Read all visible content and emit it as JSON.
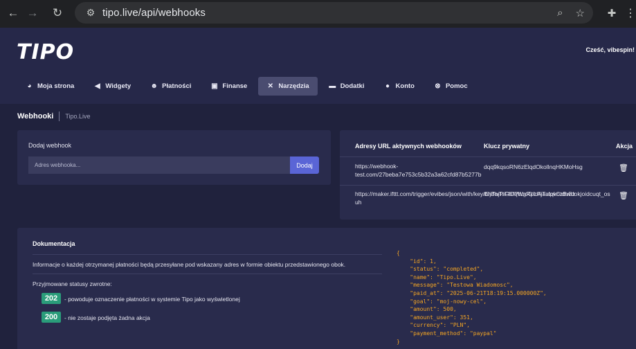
{
  "browser": {
    "url": "tipo.live/api/webhooks",
    "back_icon": "arrow-left",
    "forward_icon": "arrow-right",
    "reload_icon": "reload",
    "site_info_icon": "tune",
    "zoom_icon": "zoom",
    "star_icon": "star",
    "extensions_icon": "puzzle",
    "menu_icon": "more-vertical"
  },
  "header": {
    "logo": "TIPO",
    "greeting": "Cześć,  vibespin!"
  },
  "menu": [
    {
      "label": "Moja strona",
      "icon": "palette-icon",
      "active": false
    },
    {
      "label": "Widgety",
      "icon": "megaphone-icon",
      "active": false
    },
    {
      "label": "Płatności",
      "icon": "user-money-icon",
      "active": false
    },
    {
      "label": "Finanse",
      "icon": "briefcase-icon",
      "active": false
    },
    {
      "label": "Narzędzia",
      "icon": "tools-icon",
      "active": true
    },
    {
      "label": "Dodatki",
      "icon": "box-icon",
      "active": false
    },
    {
      "label": "Konto",
      "icon": "user-icon",
      "active": false
    },
    {
      "label": "Pomoc",
      "icon": "help-icon",
      "active": false
    }
  ],
  "breadcrumb": {
    "title": "Webhooki",
    "sub": "Tipo.Live"
  },
  "add_webhook": {
    "label": "Dodaj webhook",
    "placeholder": "Adres webhooka...",
    "button": "Dodaj"
  },
  "webhooks_table": {
    "headers": [
      "Adresy URL aktywnych webhooków",
      "Klucz prywatny",
      "Akcja"
    ],
    "rows": [
      {
        "url_line1": "https://webhook-",
        "url_line2": "test.com/27beba7e753c5b32a3a62cfd87b5277b",
        "key": "dqq9kqsoRN6zElqdOkollnqHKMoHsg"
      },
      {
        "url_line1": "https://maker.ifttt.com/trigger/evibes/json/with/key/bhTwTsFfDqWnRpzAjTutqkozBwdokjoidcuqt_os",
        "url_line2": "uh",
        "key": "tDjBbjPlGnfPbqpGlUAaalpvCtdoBz"
      }
    ]
  },
  "docs": {
    "title": "Dokumentacja",
    "intro": "Informacje o każdej otrzymanej płatności będą przesyłane pod wskazany adres w formie obiektu przedstawionego obok.",
    "statuses_label": "Przyjmowane statusy zwrotne:",
    "statuses": [
      {
        "code": "202",
        "desc": "- powoduje oznaczenie płatności w systemie Tipo jako wyświetlonej"
      },
      {
        "code": "200",
        "desc": "- nie zostaje podjęta żadna akcja"
      }
    ],
    "code_sample": "{\n    \"id\": 1,\n    \"status\": \"completed\",\n    \"name\": \"Tipo.Live\",\n    \"message\": \"Testowa Wiadomosc\",\n    \"paid_at\": \"2025-06-21T18:19:15.000000Z\",\n    \"goal\": \"moj-nowy-cel\",\n    \"amount\": 500,\n    \"amount_user\": 351,\n    \"currency\": \"PLN\",\n    \"payment_method\": \"paypal\"\n}"
  },
  "colors": {
    "accent": "#5a65d6",
    "badge": "#2a9d7a",
    "code": "#f5a623"
  }
}
